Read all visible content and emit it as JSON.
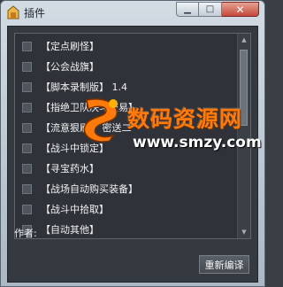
{
  "window": {
    "title": "插件",
    "buttons": {
      "minimize": "▁",
      "maximize": "□",
      "close": "✕"
    }
  },
  "plugin_list": {
    "items": [
      {
        "label": "【定点刷怪】",
        "checked": false
      },
      {
        "label": "【公会战旗】",
        "checked": false
      },
      {
        "label": "【脚本录制版】 1.4",
        "checked": false
      },
      {
        "label": "【指绝卫队决斗交易】",
        "checked": false
      },
      {
        "label": "【流意狠刷】 密送二",
        "checked": false
      },
      {
        "label": "【战斗中锁定】",
        "checked": false
      },
      {
        "label": "【寻宝药水】",
        "checked": false
      },
      {
        "label": "【战场自动购买装备】",
        "checked": false
      },
      {
        "label": "【战斗中拾取】",
        "checked": false
      },
      {
        "label": "【自动其他】",
        "checked": false
      }
    ]
  },
  "author": {
    "label": "作者:"
  },
  "actions": {
    "recompile": "重新编译"
  },
  "watermark": {
    "title": "数码资源网",
    "url": "www.smzy.com"
  },
  "colors": {
    "accent_orange": "#ff7a0a",
    "panel_bg": "#2f3339"
  }
}
